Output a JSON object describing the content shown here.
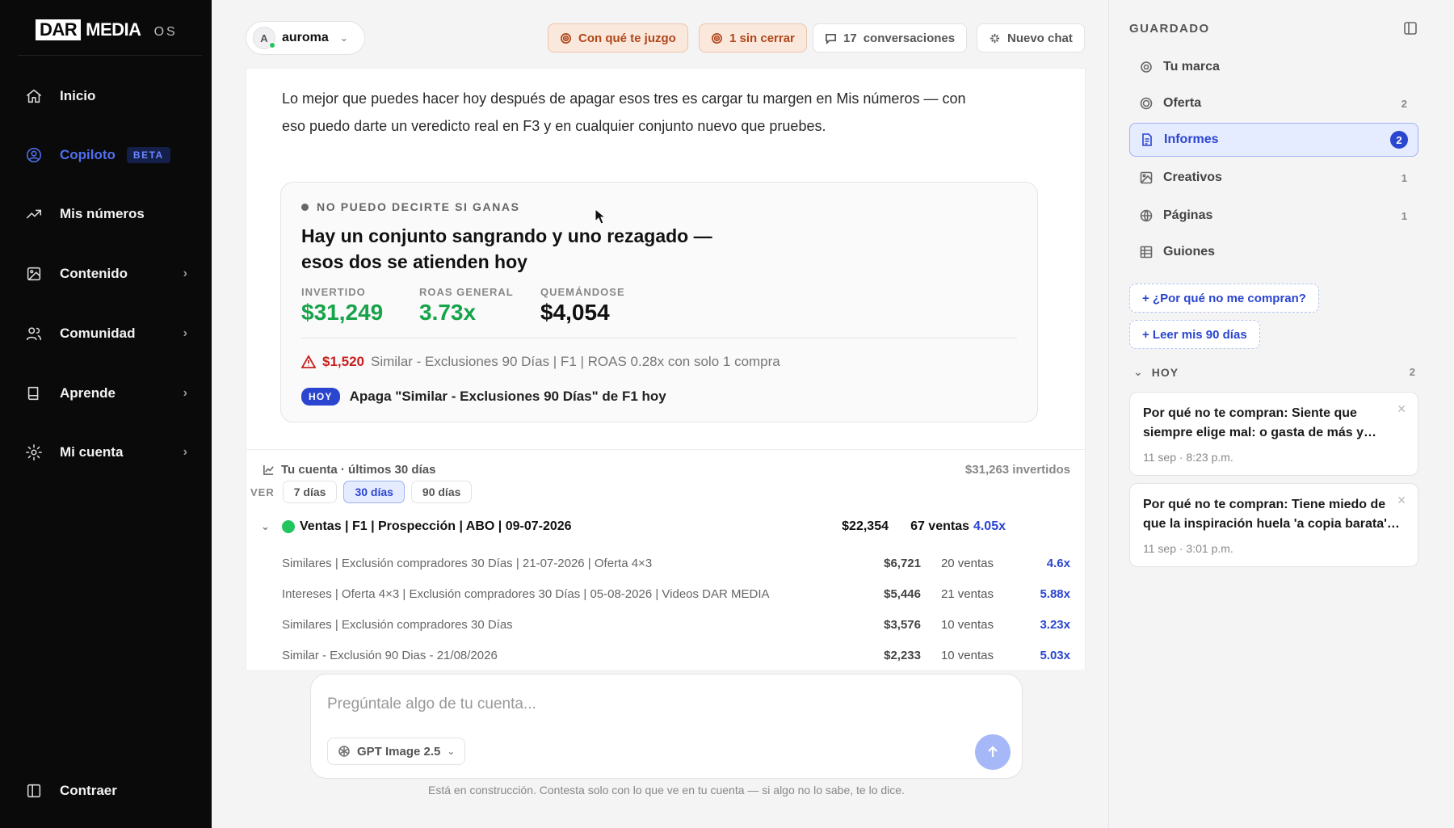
{
  "brand": {
    "box": "DAR",
    "text": "MEDIA",
    "suffix": "OS"
  },
  "sidebar": {
    "items": [
      {
        "label": "Inicio",
        "icon": "home-icon"
      },
      {
        "label": "Copiloto",
        "icon": "copilot-icon",
        "badge": "BETA",
        "active": true
      },
      {
        "label": "Mis números",
        "icon": "trend-icon"
      },
      {
        "label": "Contenido",
        "icon": "image-icon"
      },
      {
        "label": "Comunidad",
        "icon": "users-icon"
      },
      {
        "label": "Aprende",
        "icon": "book-icon"
      },
      {
        "label": "Mi cuenta",
        "icon": "gear-icon"
      }
    ],
    "collapse_label": "Contraer"
  },
  "header": {
    "workspace_initial": "A",
    "workspace_name": "auroma",
    "btn_judge": "Con qué te juzgo",
    "btn_open": "1 sin cerrar",
    "btn_convs_count": "17",
    "btn_convs_label": "conversaciones",
    "btn_new": "Nuevo chat"
  },
  "message": {
    "text": "Lo mejor que puedes hacer hoy después de apagar esos tres es cargar tu margen en Mis números — con eso puedo darte un veredicto real en F3 y en cualquier conjunto nuevo que pruebes."
  },
  "verdict": {
    "eyebrow": "NO PUEDO DECIRTE SI GANAS",
    "title": "Hay un conjunto sangrando y uno rezagado — esos dos se atienden hoy",
    "kpis": [
      {
        "label": "INVERTIDO",
        "value": "$31,249"
      },
      {
        "label": "ROAS GENERAL",
        "value": "3.73x"
      },
      {
        "label": "QUEMÁNDOSE",
        "value": "$4,054"
      }
    ],
    "warning_amount": "$1,520",
    "warning_text": "Similar - Exclusiones 90 Días | F1 | ROAS 0.28x con solo 1 compra",
    "action_badge": "HOY",
    "action_text": "Apaga \"Similar - Exclusiones 90 Días\" de F1 hoy"
  },
  "account": {
    "title": "Tu cuenta · últimos 30 días",
    "total": "$31,263 invertidos",
    "ver_label": "VER",
    "ranges": [
      "7 días",
      "30 días",
      "90 días"
    ],
    "campaign": {
      "name": "Ventas | F1 | Prospección | ABO | 09-07-2026",
      "spend": "$22,354",
      "sales": "67 ventas",
      "roas": "4.05x"
    },
    "adsets": [
      {
        "name": "Similares | Exclusión compradores 30 Días | 21-07-2026 | Oferta 4×3",
        "spend": "$6,721",
        "sales": "20 ventas",
        "roas": "4.6x"
      },
      {
        "name": "Intereses | Oferta 4×3 | Exclusión compradores 30 Días | 05-08-2026 | Videos DAR MEDIA",
        "spend": "$5,446",
        "sales": "21 ventas",
        "roas": "5.88x"
      },
      {
        "name": "Similares | Exclusión compradores 30 Días",
        "spend": "$3,576",
        "sales": "10 ventas",
        "roas": "3.23x"
      },
      {
        "name": "Similar - Exclusión 90 Dias - 21/08/2026",
        "spend": "$2,233",
        "sales": "10 ventas",
        "roas": "5.03x"
      }
    ]
  },
  "composer": {
    "placeholder": "Pregúntale algo de tu cuenta...",
    "model": "GPT Image 2.5",
    "disclaimer": "Está en construcción. Contesta solo con lo que ve en tu cuenta — si algo no lo sabe, te lo dice."
  },
  "saved": {
    "title": "GUARDADO",
    "items": [
      {
        "label": "Tu marca",
        "count": ""
      },
      {
        "label": "Oferta",
        "count": "2"
      },
      {
        "label": "Informes",
        "count": "2"
      },
      {
        "label": "Creativos",
        "count": "1"
      },
      {
        "label": "Páginas",
        "count": "1"
      },
      {
        "label": "Guiones",
        "count": ""
      }
    ],
    "chips": [
      "+ ¿Por qué no me compran?",
      "+ Leer mis 90 días"
    ],
    "today_label": "HOY",
    "today_count": "2",
    "notes": [
      {
        "title": "Por qué no te compran: Siente que siempre elige mal: o gasta de más y siempre sale perdiendo",
        "date": "11 sep · 8:23 p.m."
      },
      {
        "title": "Por qué no te compran: Tiene miedo de que la inspiración huela 'a copia barata' y quede mal",
        "date": "11 sep · 3:01 p.m."
      }
    ]
  }
}
